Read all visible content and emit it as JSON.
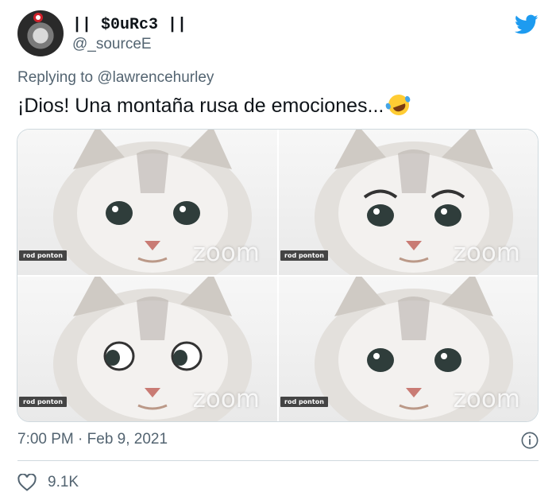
{
  "author": {
    "display_name": "|| $0uRc3 ||",
    "handle": "@_sourceE",
    "avatar_icon": "avatar-photo"
  },
  "reply": {
    "prefix": "Replying to ",
    "to": "@lawrencehurley"
  },
  "tweet": {
    "text": "¡Dios! Una montaña rusa de emociones...",
    "emoji": "rolling-on-floor-laughing-emoji"
  },
  "media": {
    "panels": [
      {
        "name_tag": "rod ponton",
        "watermark": "zoom",
        "expression": "neutral"
      },
      {
        "name_tag": "rod ponton",
        "watermark": "zoom",
        "expression": "raised-brows"
      },
      {
        "name_tag": "rod ponton",
        "watermark": "zoom",
        "expression": "eyes-side"
      },
      {
        "name_tag": "rod ponton",
        "watermark": "zoom",
        "expression": "neutral"
      }
    ]
  },
  "meta": {
    "timestamp": "7:00 PM · Feb 9, 2021",
    "likes": "9.1K"
  },
  "colors": {
    "twitter_blue": "#1d9bf0",
    "secondary_text": "#536471",
    "border": "#cfd9de"
  }
}
